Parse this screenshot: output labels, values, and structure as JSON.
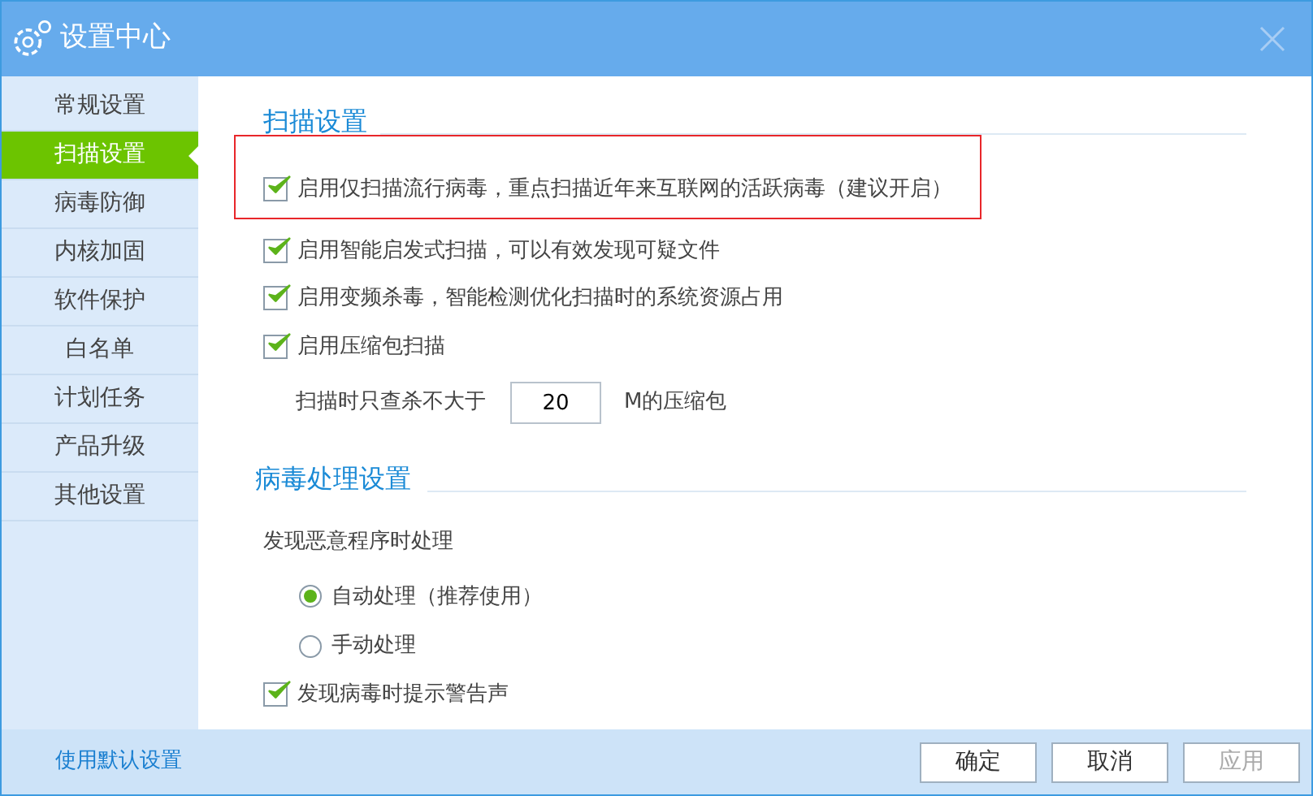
{
  "window": {
    "title": "设置中心"
  },
  "sidebar": {
    "items": [
      {
        "label": "常规设置",
        "selected": false
      },
      {
        "label": "扫描设置",
        "selected": true
      },
      {
        "label": "病毒防御",
        "selected": false
      },
      {
        "label": "内核加固",
        "selected": false
      },
      {
        "label": "软件保护",
        "selected": false
      },
      {
        "label": "白名单",
        "selected": false
      },
      {
        "label": "计划任务",
        "selected": false
      },
      {
        "label": "产品升级",
        "selected": false
      },
      {
        "label": "其他设置",
        "selected": false
      }
    ]
  },
  "scan_settings": {
    "title": "扫描设置",
    "options": [
      {
        "label": "启用仅扫描流行病毒，重点扫描近年来互联网的活跃病毒（建议开启）",
        "checked": true,
        "highlighted": true
      },
      {
        "label": "启用智能启发式扫描，可以有效发现可疑文件",
        "checked": true,
        "highlighted": false
      },
      {
        "label": "启用变频杀毒，智能检测优化扫描时的系统资源占用",
        "checked": true,
        "highlighted": false
      },
      {
        "label": "启用压缩包扫描",
        "checked": true,
        "highlighted": false
      }
    ],
    "size_limit": {
      "label": "扫描时只查杀不大于",
      "value": "20",
      "unit": "M的压缩包"
    }
  },
  "virus_handling": {
    "title": "病毒处理设置",
    "prompt": "发现恶意程序时处理",
    "radios": [
      {
        "label": "自动处理（推荐使用）",
        "selected": true
      },
      {
        "label": "手动处理",
        "selected": false
      }
    ],
    "alert_sound": {
      "label": "发现病毒时提示警告声",
      "checked": true
    }
  },
  "footer": {
    "default_link": "使用默认设置",
    "buttons": [
      {
        "label": "确定",
        "disabled": false
      },
      {
        "label": "取消",
        "disabled": false
      },
      {
        "label": "应用",
        "disabled": true
      }
    ]
  }
}
